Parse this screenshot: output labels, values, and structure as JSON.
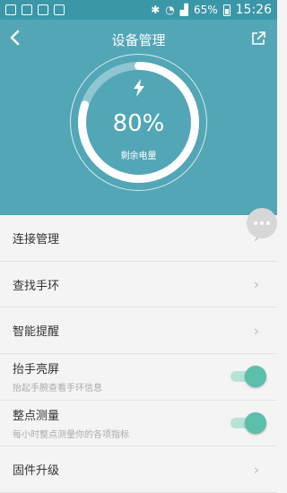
{
  "status_bar": {
    "battery_text": "65%",
    "time": "15:26"
  },
  "header": {
    "title": "设备管理",
    "back_icon": "chevron-left-icon",
    "share_icon": "external-link-icon"
  },
  "gauge": {
    "percent_text": "80%",
    "percent_value": 0.8,
    "caption": "剩余电量",
    "icon": "lightning-bolt-icon"
  },
  "list": {
    "items": [
      {
        "label": "连接管理"
      },
      {
        "label": "查找手环"
      },
      {
        "label": "智能提醒"
      },
      {
        "label": "抬手亮屏",
        "sub": "抬起手腕查看手环信息",
        "toggle_on": true
      },
      {
        "label": "整点测量",
        "sub": "每小时整点测量你的各项指标",
        "toggle_on": true
      },
      {
        "label": "固件升级"
      }
    ]
  },
  "colors": {
    "header": "#52a6b6",
    "statusbar": "#3a97a7",
    "toggle": "#5bbfa9"
  }
}
